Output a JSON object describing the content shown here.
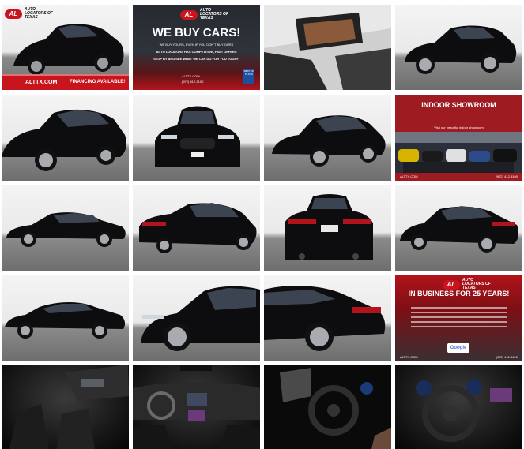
{
  "gallery": {
    "tile1": {
      "logo_name": "AUTO LOCATORS OF TEXAS",
      "site": "ALTTX.COM",
      "financing": "FINANCING AVAILABLE!"
    },
    "tile2": {
      "logo_name": "AUTO LOCATORS OF TEXAS",
      "headline": "WE BUY CARS!",
      "line1": "WE BUY YOURS, EVEN IF YOU DON'T BUY OURS",
      "line2": "AUTO LOCATORS HAS COMPETITIVE, FAST OFFERS",
      "line3": "STOP BY AND SEE WHAT WE CAN DO FOR YOU TODAY!",
      "site": "ALTTX.COM",
      "phone": "(972) 412-3100",
      "badge": "BEST OF PLANO"
    },
    "tile8": {
      "headline": "INDOOR SHOWROOM",
      "subline": "Visit our beautiful indoor showroom",
      "site": "ALTTX.COM",
      "phone": "(972) 412-3100"
    },
    "tile16": {
      "logo_name": "AUTO LOCATORS OF TEXAS",
      "headline": "IN BUSINESS FOR 25 YEARS!",
      "badge": "Google",
      "site": "ALTTX.COM",
      "phone": "(972) 412-3100"
    }
  },
  "colors": {
    "brand_red": "#c8141c",
    "car_black": "#0d0d0f",
    "floor_gray": "#7a7a7a"
  }
}
